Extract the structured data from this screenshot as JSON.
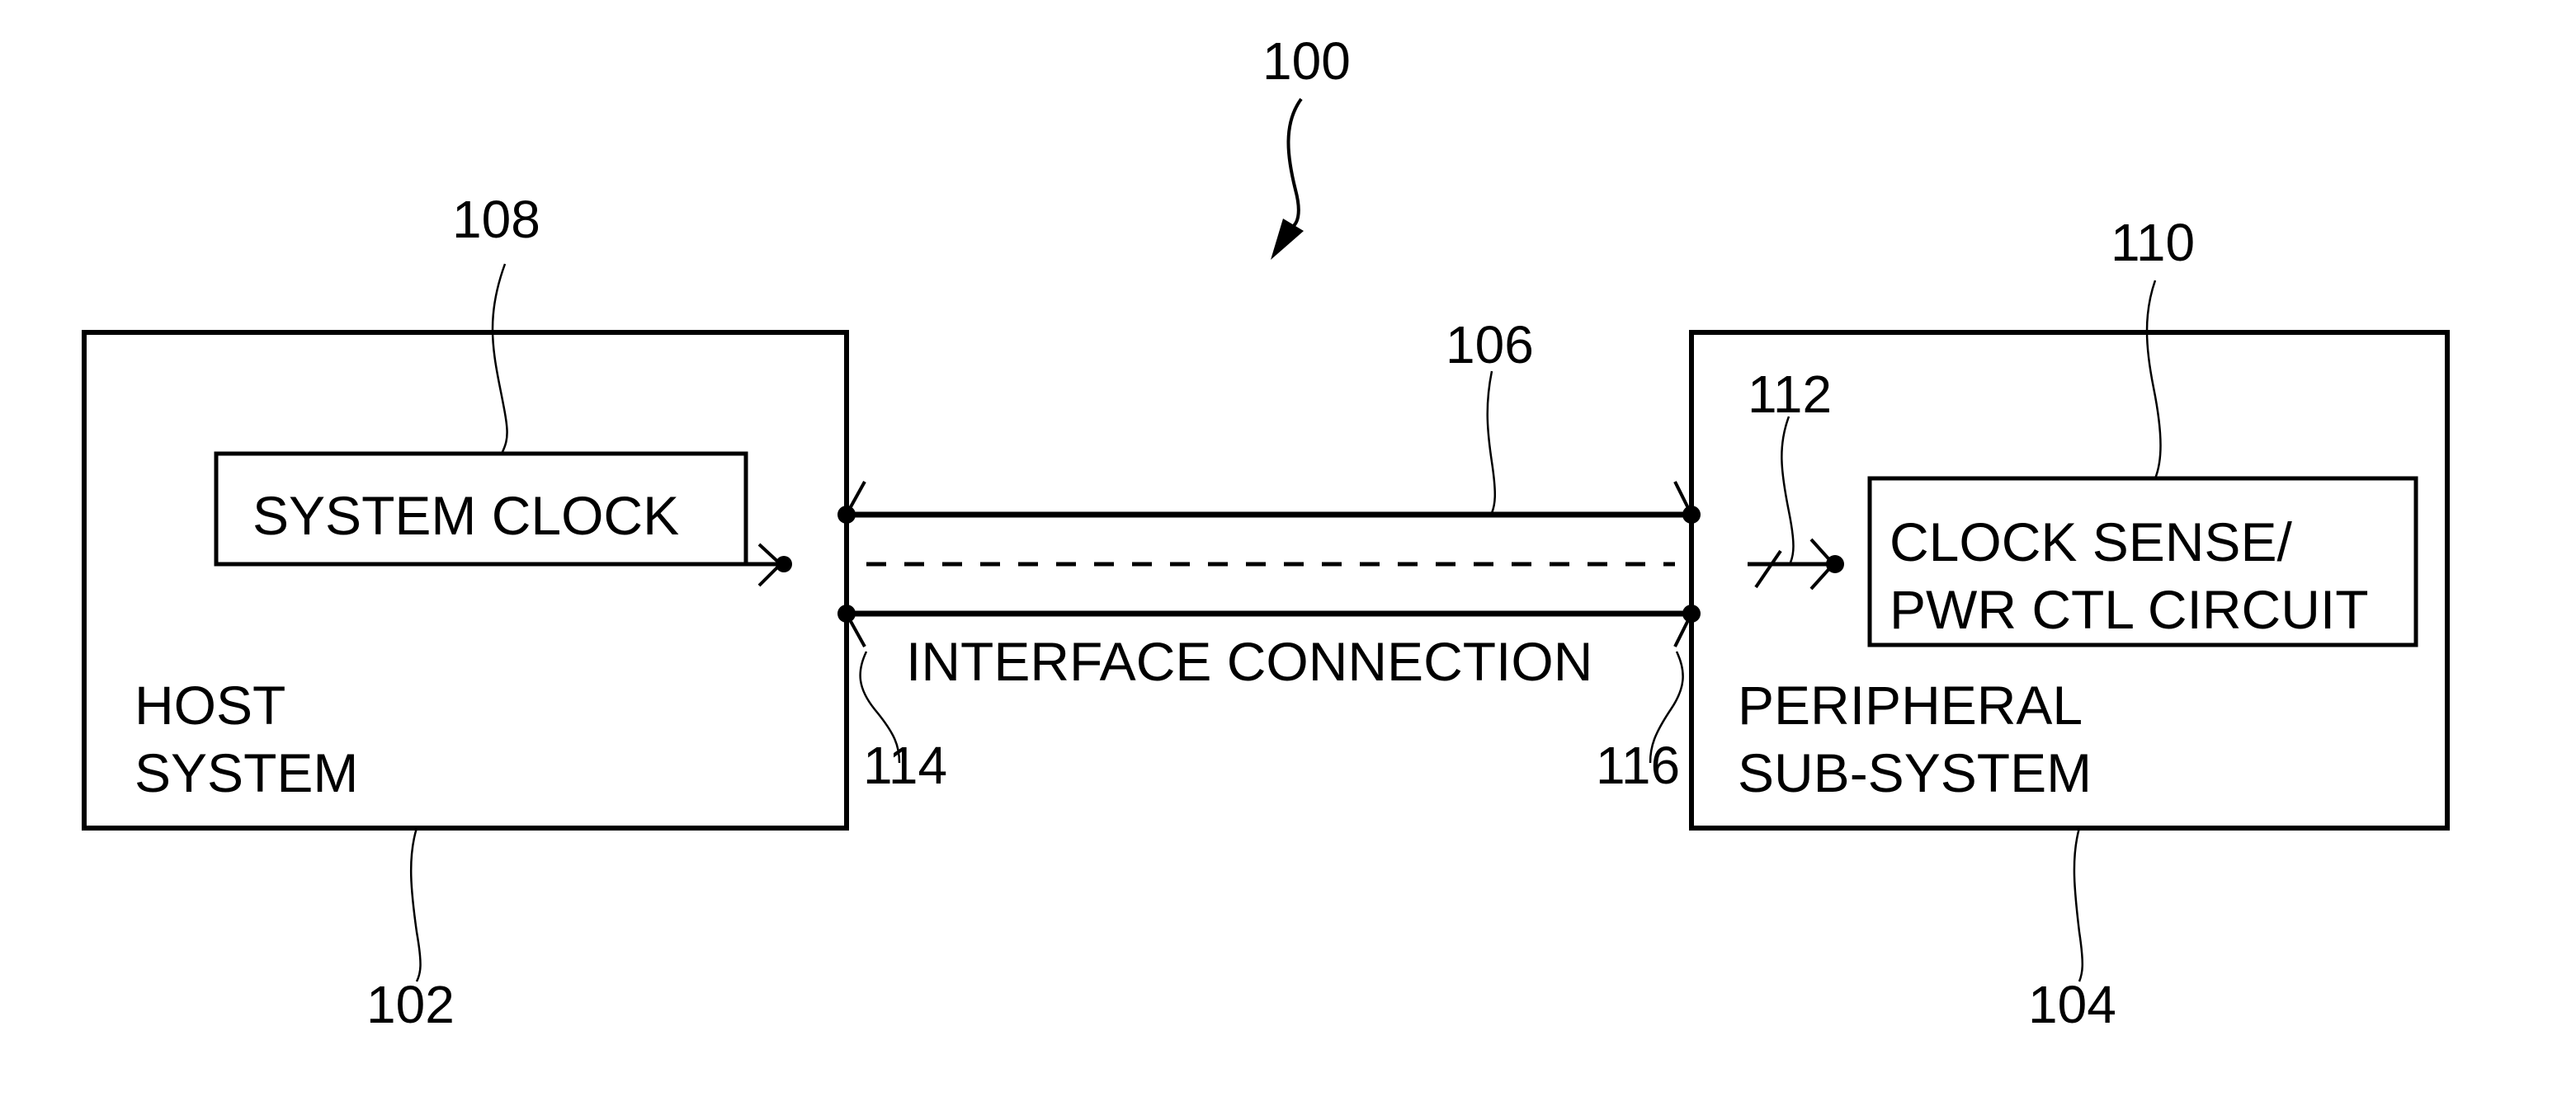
{
  "figure": {
    "reference": "100"
  },
  "host_system": {
    "label_lines": [
      "HOST",
      "SYSTEM"
    ],
    "reference": "102",
    "system_clock": {
      "label": "SYSTEM CLOCK",
      "reference": "108"
    }
  },
  "interface": {
    "label": "INTERFACE CONNECTION",
    "reference": "106",
    "left_terminal_reference": "114",
    "right_terminal_reference": "116"
  },
  "peripheral_subsystem": {
    "label_lines": [
      "PERIPHERAL",
      "SUB-SYSTEM"
    ],
    "reference": "104",
    "clock_input_reference": "112",
    "clock_sense_circuit": {
      "label_lines": [
        "CLOCK SENSE/",
        "PWR CTL CIRCUIT"
      ],
      "reference": "110"
    }
  }
}
